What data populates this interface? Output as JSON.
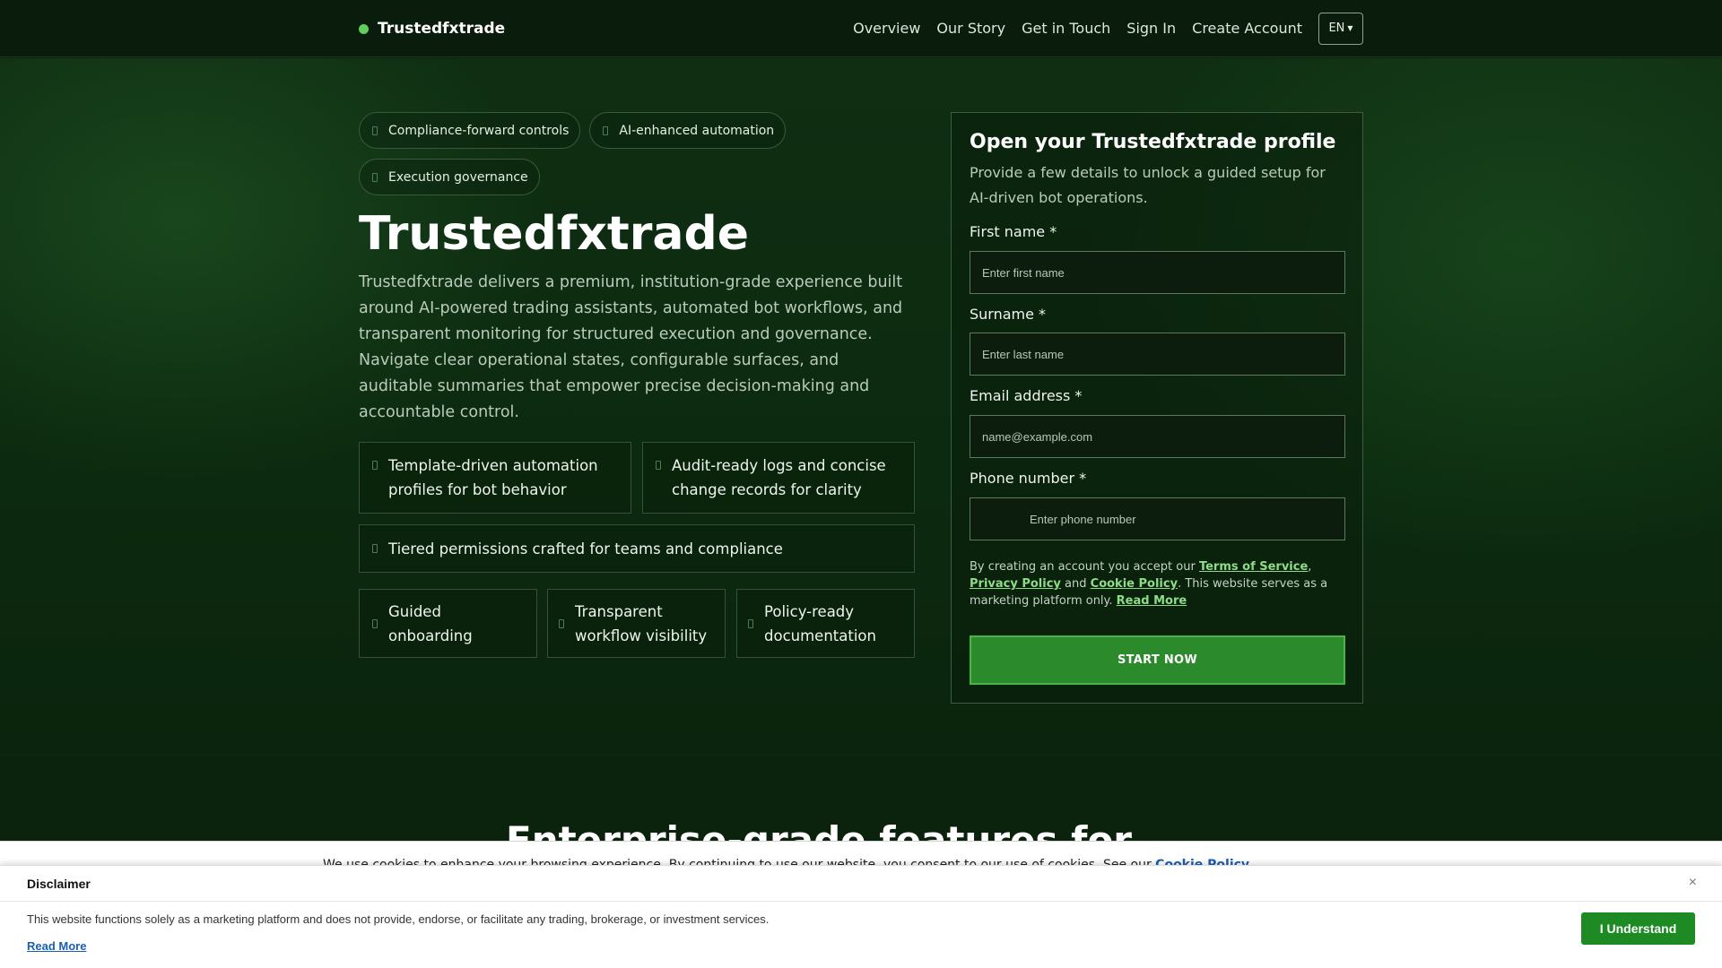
{
  "header": {
    "brand": "Trustedfxtrade",
    "nav": [
      "Overview",
      "Our Story",
      "Get in Touch",
      "Sign In",
      "Create Account"
    ],
    "language": "EN"
  },
  "hero": {
    "pills": [
      "Compliance-forward controls",
      "AI-enhanced automation",
      "Execution governance"
    ],
    "title": "Trustedfxtrade",
    "description": "Trustedfxtrade delivers a premium, institution-grade experience built around AI-powered trading assistants, automated bot workflows, and transparent monitoring for structured execution and governance. Navigate clear operational states, configurable surfaces, and auditable summaries that empower precise decision-making and accountable control.",
    "features": [
      "Template-driven automation profiles for bot behavior",
      "Audit-ready logs and concise change records for clarity",
      "Tiered permissions crafted for teams and compliance",
      "Guided onboarding",
      "Transparent workflow visibility",
      "Policy-ready documentation"
    ]
  },
  "form": {
    "title": "Open your Trustedfxtrade profile",
    "subtitle": "Provide a few details to unlock a guided setup for AI-driven bot operations.",
    "first_name_label": "First name *",
    "first_name_placeholder": "Enter first name",
    "surname_label": "Surname *",
    "surname_placeholder": "Enter last name",
    "email_label": "Email address *",
    "email_placeholder": "name@example.com",
    "phone_label": "Phone number *",
    "phone_placeholder": "Enter phone number",
    "legal_prefix": "By creating an account you accept our",
    "terms": "Terms of Service",
    "privacy": "Privacy Policy",
    "and": "and",
    "cookie": "Cookie Policy",
    "legal_suffix": ". This website serves as a marketing platform only.",
    "read_more": "Read More",
    "submit": "START NOW"
  },
  "section2": {
    "title": "Enterprise-grade features for"
  },
  "cookie_bar": {
    "text": "We use cookies to enhance your browsing experience. By continuing to use our website, you consent to our use of cookies. See our",
    "link": "Cookie Policy"
  },
  "disclaimer": {
    "title": "Disclaimer",
    "close": "×",
    "text": "This website functions solely as a marketing platform and does not provide, endorse, or facilitate any trading, brokerage, or investment services.",
    "read_more": "Read More",
    "button": "I Understand"
  },
  "colors": {
    "accent": "#2a8a2c",
    "brand_dot": "#5fcf5c",
    "link": "#8fdb8a",
    "background": "#0b210d"
  }
}
